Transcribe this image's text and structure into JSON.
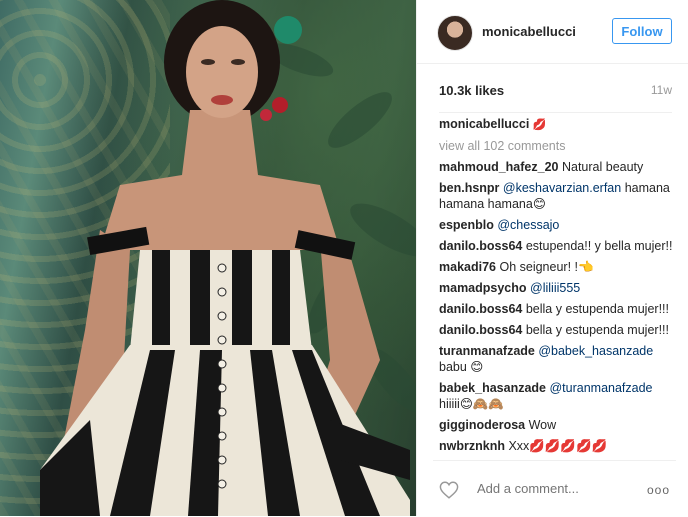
{
  "post": {
    "username": "monicabellucci",
    "follow_label": "Follow",
    "likes": "10.3k likes",
    "age": "11w",
    "caption": {
      "user": "monicabellucci",
      "text": "💋"
    },
    "view_all": "view all 102 comments",
    "comments": [
      {
        "user": "mahmoud_hafez_20",
        "text": "Natural beauty"
      },
      {
        "user": "ben.hsnpr",
        "mention": "@keshavarzian.erfan",
        "text": "hamana hamana hamana😊"
      },
      {
        "user": "espenblo",
        "mention": "@chessajo",
        "text": ""
      },
      {
        "user": "danilo.boss64",
        "text": "estupenda!! y bella mujer!!"
      },
      {
        "user": "makadi76",
        "text": "Oh seigneur! !👈"
      },
      {
        "user": "mamadpsycho",
        "mention": "@liliii555",
        "text": ""
      },
      {
        "user": "danilo.boss64",
        "text": "bella y estupenda mujer!!!"
      },
      {
        "user": "danilo.boss64",
        "text": "bella y estupenda mujer!!!"
      },
      {
        "user": "turanmanafzade",
        "mention": "@babek_hasanzade",
        "text": "babu 😊"
      },
      {
        "user": "babek_hasanzade",
        "mention": "@turanmanafzade",
        "text": "hiiiii😊🙈🙈"
      },
      {
        "user": "gigginoderosa",
        "text": "Wow"
      },
      {
        "user": "nwbrznknh",
        "text": "Xxx💋💋💋💋💋"
      }
    ],
    "add_comment_placeholder": "Add a comment...",
    "more_label": "ooo"
  },
  "icons": {
    "like": "heart-icon",
    "more": "more-options-icon"
  },
  "colors": {
    "link": "#3897f0",
    "mention": "#003569",
    "muted": "#999999"
  }
}
